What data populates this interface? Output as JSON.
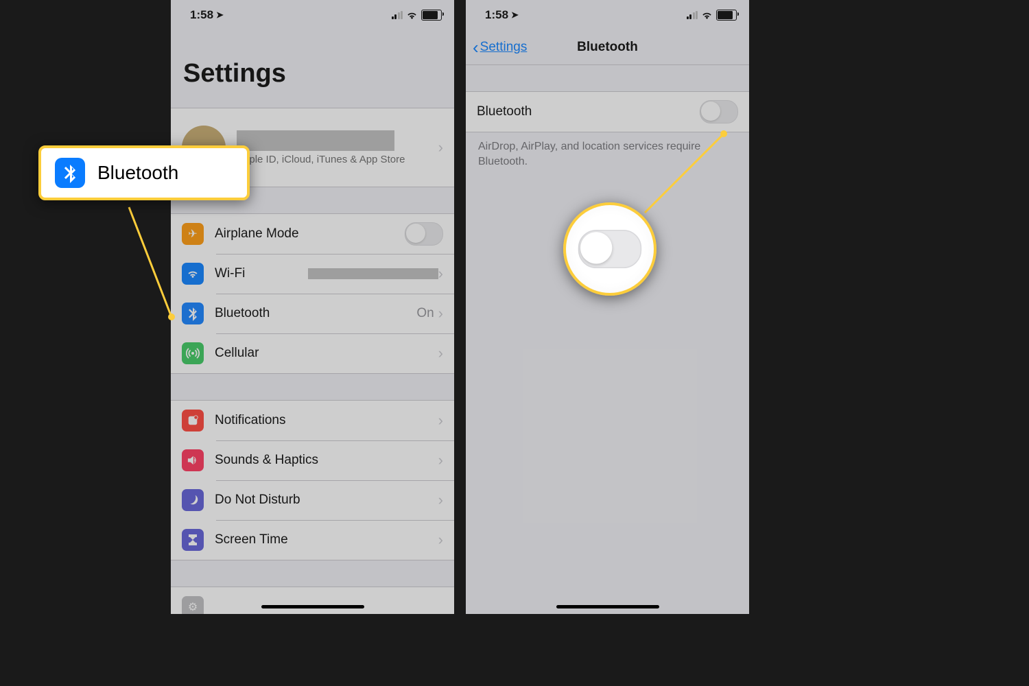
{
  "status": {
    "time": "1:58"
  },
  "left": {
    "title": "Settings",
    "profile_sub": "Apple ID, iCloud, iTunes & App Store",
    "rows": {
      "airplane": "Airplane Mode",
      "wifi": "Wi-Fi",
      "bluetooth": "Bluetooth",
      "bluetooth_value": "On",
      "cellular": "Cellular",
      "notifications": "Notifications",
      "sounds": "Sounds & Haptics",
      "dnd": "Do Not Disturb",
      "screentime": "Screen Time"
    }
  },
  "right": {
    "back": "Settings",
    "title": "Bluetooth",
    "toggle_label": "Bluetooth",
    "footer": "AirDrop, AirPlay, and location services require Bluetooth."
  },
  "callout": {
    "bluetooth_label": "Bluetooth"
  }
}
